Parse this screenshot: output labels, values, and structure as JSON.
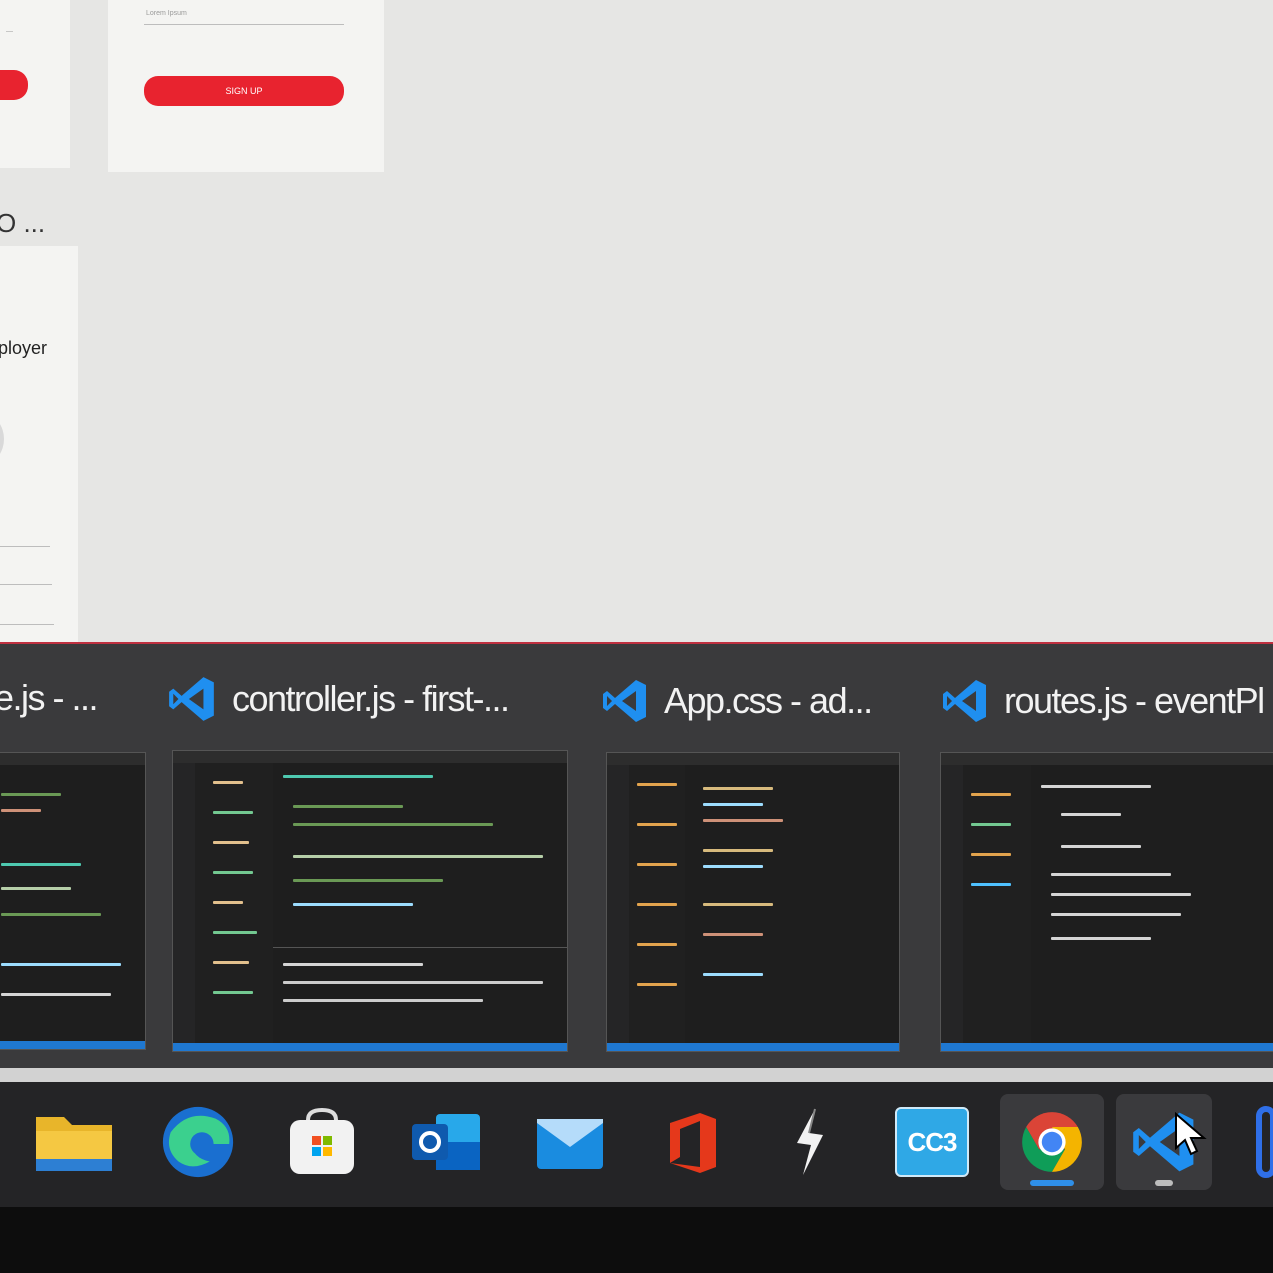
{
  "background_page": {
    "signup_button": "SIGN UP",
    "field_placeholder": "Lorem Ipsum",
    "section_heading": "O ...",
    "card_label": "ployer"
  },
  "task_view": {
    "windows": [
      {
        "title": "e.js - ...",
        "app": "Visual Studio Code"
      },
      {
        "title": "controller.js - first-...",
        "app": "Visual Studio Code"
      },
      {
        "title": "App.css - ad...",
        "app": "Visual Studio Code"
      },
      {
        "title": "routes.js - eventPl",
        "app": "Visual Studio Code"
      }
    ]
  },
  "taskbar": {
    "apps": [
      {
        "name": "File Explorer",
        "icon": "folder-icon"
      },
      {
        "name": "Microsoft Edge",
        "icon": "edge-icon"
      },
      {
        "name": "Microsoft Store",
        "icon": "store-icon"
      },
      {
        "name": "Outlook",
        "icon": "outlook-icon"
      },
      {
        "name": "Mail",
        "icon": "mail-icon"
      },
      {
        "name": "Office",
        "icon": "office-icon"
      },
      {
        "name": "Lightning app",
        "icon": "lightning-icon"
      },
      {
        "name": "CC3",
        "icon": "cc3-icon",
        "label": "CC3"
      },
      {
        "name": "Google Chrome",
        "icon": "chrome-icon",
        "running": true,
        "active": true
      },
      {
        "name": "Visual Studio Code",
        "icon": "vscode-icon",
        "running": true,
        "selected": true
      }
    ]
  },
  "colors": {
    "accent_red": "#e8232f",
    "vscode_blue": "#1f78d1",
    "chrome_indicator": "#2f8fe8"
  }
}
